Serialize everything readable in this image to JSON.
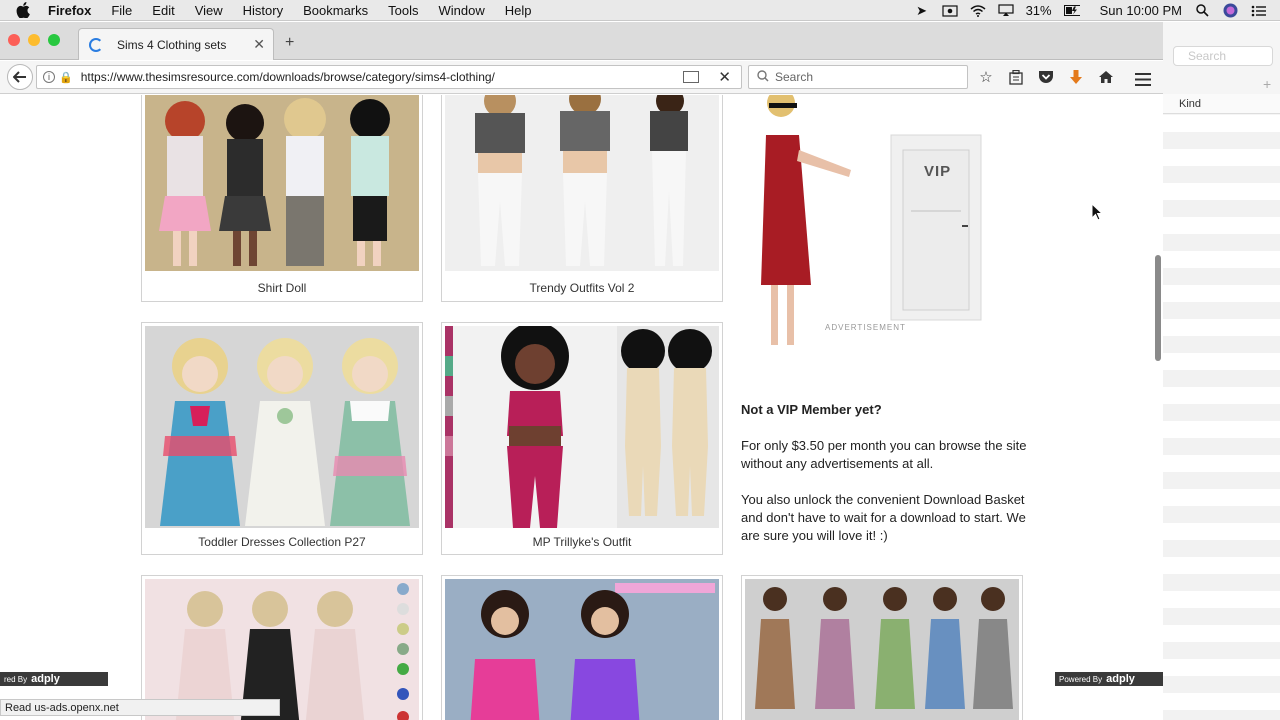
{
  "menubar": {
    "app_name": "Firefox",
    "items": [
      "File",
      "Edit",
      "View",
      "History",
      "Bookmarks",
      "Tools",
      "Window",
      "Help"
    ],
    "battery": "31%",
    "clock": "Sun 10:00 PM"
  },
  "browser": {
    "tab_title": "Sims 4 Clothing sets",
    "url": "https://www.thesimsresource.com/downloads/browse/category/sims4-clothing/",
    "search_placeholder": "Search",
    "status_text": "Read us-ads.openx.net"
  },
  "page": {
    "cards": [
      {
        "caption": "Shirt Doll"
      },
      {
        "caption": "Trendy Outfits Vol 2"
      },
      {
        "caption": "Toddler Dresses Collection P27"
      },
      {
        "caption": "MP Trillyke's Outfit"
      }
    ],
    "ad": {
      "door_label": "VIP",
      "label": "ADVERTISEMENT"
    },
    "vip": {
      "title": "Not a VIP Member yet?",
      "para1": "For only $3.50 per month you can browse the site without any advertisements at all.",
      "para2": "You also unlock the convenient Download Basket and don't have to wait for a download to start. We are sure you will love it! :)"
    },
    "powered_left": "red By",
    "powered_right": "Powered By",
    "powered_brand": "adply"
  },
  "bg_window": {
    "search_placeholder": "Search",
    "column_header": "Kind"
  },
  "colors": {
    "accent": "#2a7de1",
    "lock": "#e4a21b"
  }
}
